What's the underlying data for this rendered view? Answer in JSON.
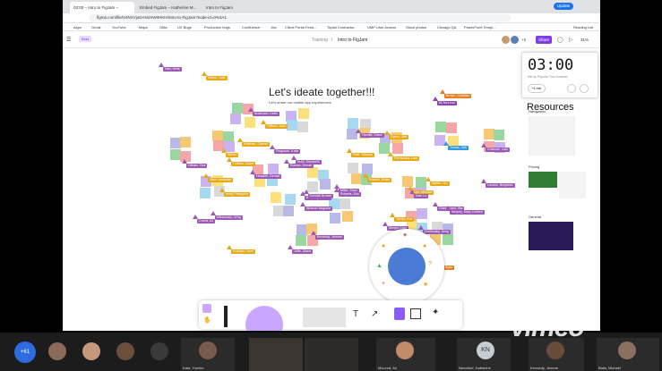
{
  "browser": {
    "tabs": [
      "03:00 – Intro to FigJam –",
      "Embed FigJam – Katherine M...",
      "Intro to FigJam"
    ],
    "url": "figma.com/file/V4NXVjoDAN4XW8HKH/Intro-to-FigJam?node-id=0%3A1",
    "update_label": "Update",
    "bookmarks": [
      "Apps",
      "Gmail",
      "YouTube",
      "Maps",
      "Okta",
      "UX Bugs",
      "Production bugs",
      "Confluence",
      "Jira",
      "Client Portal Feed...",
      "Toptal Contractor...",
      "UMP User Access",
      "Stock photos",
      "Chicago QA",
      "PowerPoint Templ...",
      "Reading List"
    ]
  },
  "figma": {
    "badge": "Beta",
    "breadcrumb_parent": "Training",
    "breadcrumb_sep": "/",
    "file_name": "Intro to FigJam",
    "share_label": "Share",
    "zoom": "31%",
    "avatar_count": "+5"
  },
  "board": {
    "title": "Let's ideate together!!!",
    "subtitle": "Let's share our mobile app experiences"
  },
  "timer": {
    "time": "03:00",
    "caption": "Set by Popular Tom Summer",
    "add_label": "+1 min"
  },
  "sidebar": {
    "heading": "Resources",
    "sections": [
      "Navigation",
      "Pricing",
      "General"
    ]
  },
  "cursors": [
    {
      "name": "Han, Write",
      "color": "#9b59b6"
    },
    {
      "name": "Simon, Julie",
      "color": "#e6a817"
    },
    {
      "name": "Brown, Christian",
      "color": "#e67e22"
    },
    {
      "name": "Ali McLeod",
      "color": "#8e44ad"
    },
    {
      "name": "Anderson, Keith",
      "color": "#9b59b6"
    },
    {
      "name": "Clifford, John",
      "color": "#e6a817"
    },
    {
      "name": "Harrilla, Diane",
      "color": "#9b59b6"
    },
    {
      "name": "Oyero, Jide",
      "color": "#e6a817"
    },
    {
      "name": "Tomas, Sub",
      "color": "#3498db"
    },
    {
      "name": "Chidozie, Lisa",
      "color": "#9b59b6"
    },
    {
      "name": "Olthan, Tina",
      "color": "#9b59b6"
    },
    {
      "name": "Adrian",
      "color": "#e6a817"
    },
    {
      "name": "Ferguson, Katie",
      "color": "#9b59b6"
    },
    {
      "name": "O'Brian, David",
      "color": "#e6a817"
    },
    {
      "name": "Kulik, Elizabeth",
      "color": "#9b59b6"
    },
    {
      "name": "Rule, Yolanda",
      "color": "#e6a817"
    },
    {
      "name": "Fernandes, Lisa",
      "color": "#e6a817"
    },
    {
      "name": "Rumao, Denah",
      "color": "#9b59b6"
    },
    {
      "name": "Hoffman, Gabriel",
      "color": "#e6a817"
    },
    {
      "name": "Heaslen, Denise",
      "color": "#9b59b6"
    },
    {
      "name": "Josh Lancaster",
      "color": "#e6a817"
    },
    {
      "name": "Andy Pellegrino",
      "color": "#e6a817"
    },
    {
      "name": "Kimberly Barnes",
      "color": "#9b59b6"
    },
    {
      "name": "Miller, Shan",
      "color": "#9b59b6"
    },
    {
      "name": "Russell, Robin",
      "color": "#e6a817"
    },
    {
      "name": "Roberts, Eric",
      "color": "#9b59b6"
    },
    {
      "name": "Kendall Brower",
      "color": "#9b59b6"
    },
    {
      "name": "Martin, Jim",
      "color": "#e6a817"
    },
    {
      "name": "Lee, Michael",
      "color": "#e6a817"
    },
    {
      "name": "Kate Lu",
      "color": "#9b59b6"
    },
    {
      "name": "Luzano, Benjamin",
      "color": "#9b59b6"
    },
    {
      "name": "Athena Hargrave",
      "color": "#9b59b6"
    },
    {
      "name": "Chideauxed, Bia",
      "color": "#9b59b6"
    },
    {
      "name": "Murphy, Mary Colleen",
      "color": "#9b59b6"
    },
    {
      "name": "Missowary, Greg",
      "color": "#9b59b6"
    },
    {
      "name": "Corvis, AJ",
      "color": "#9b59b6"
    },
    {
      "name": "Varela, Eric",
      "color": "#e6a817"
    },
    {
      "name": "Allegra Gray",
      "color": "#9b59b6"
    },
    {
      "name": "Kennedy, Jerome",
      "color": "#9b59b6"
    },
    {
      "name": "Dombosky, Greg",
      "color": "#9b59b6"
    },
    {
      "name": "Rudolph, Noel",
      "color": "#e6a817"
    },
    {
      "name": "Joffe, Diana",
      "color": "#9b59b6"
    },
    {
      "name": "Hart, Ryan",
      "color": "#e67e22"
    }
  ],
  "toolbar": {
    "tools": [
      "select-tool",
      "hand-tool",
      "marker-tool",
      "shape-tool",
      "sticky-tool",
      "text-tool",
      "connector-tool",
      "section-tool",
      "table-tool",
      "plugin-tool"
    ]
  },
  "meeting": {
    "extra_count": "+61",
    "participants": [
      "Kato, Yumiko",
      "McLeod, Ali",
      "Nenddorf, Katherine",
      "Kennedy, Jerome",
      "Batis, Michael"
    ],
    "initials": "KN",
    "watermark": "vimeo"
  }
}
